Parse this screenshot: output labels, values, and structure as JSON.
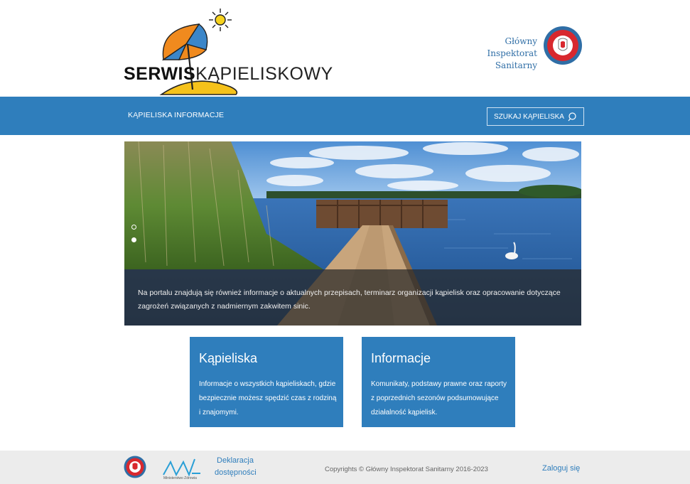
{
  "header": {
    "logo_bold": "SERWIS",
    "logo_light": "KĄPIELISKOWY",
    "inspectorate_line1": "Główny Inspektorat",
    "inspectorate_line2": "Sanitarny"
  },
  "nav": {
    "items": [
      {
        "label": "KĄPIELISKA"
      },
      {
        "label": "INFORMACJE"
      }
    ],
    "search_label": "SZUKAJ KĄPIELISKA",
    "search_icon": "search-icon"
  },
  "hero": {
    "caption": "Na portalu znajdują się również informacje o aktualnych przepisach, terminarz organizacji kąpielisk oraz opracowanie dotyczące zagrożeń związanych z nadmiernym zakwitem sinic.",
    "slides_count": 2,
    "active_slide": 2
  },
  "cards": [
    {
      "title": "Kąpieliska",
      "text": "Informacje o wszystkich kąpieliskach, gdzie bezpiecznie możesz spędzić czas z rodziną i znajomymi."
    },
    {
      "title": "Informacje",
      "text": "Komunikaty, podstawy prawne oraz raporty z poprzednich sezonów podsumowujące działalność kąpielisk."
    }
  ],
  "footer": {
    "ministry_label": "Ministerstwo Zdrowia",
    "declaration": "Deklaracja dostępności",
    "copyright": "Copyrights © Główny Inspektorat Sanitarny 2016-2023",
    "login": "Zaloguj się"
  },
  "colors": {
    "brand_blue": "#2f7ebc",
    "footer_bg": "#ececec"
  }
}
